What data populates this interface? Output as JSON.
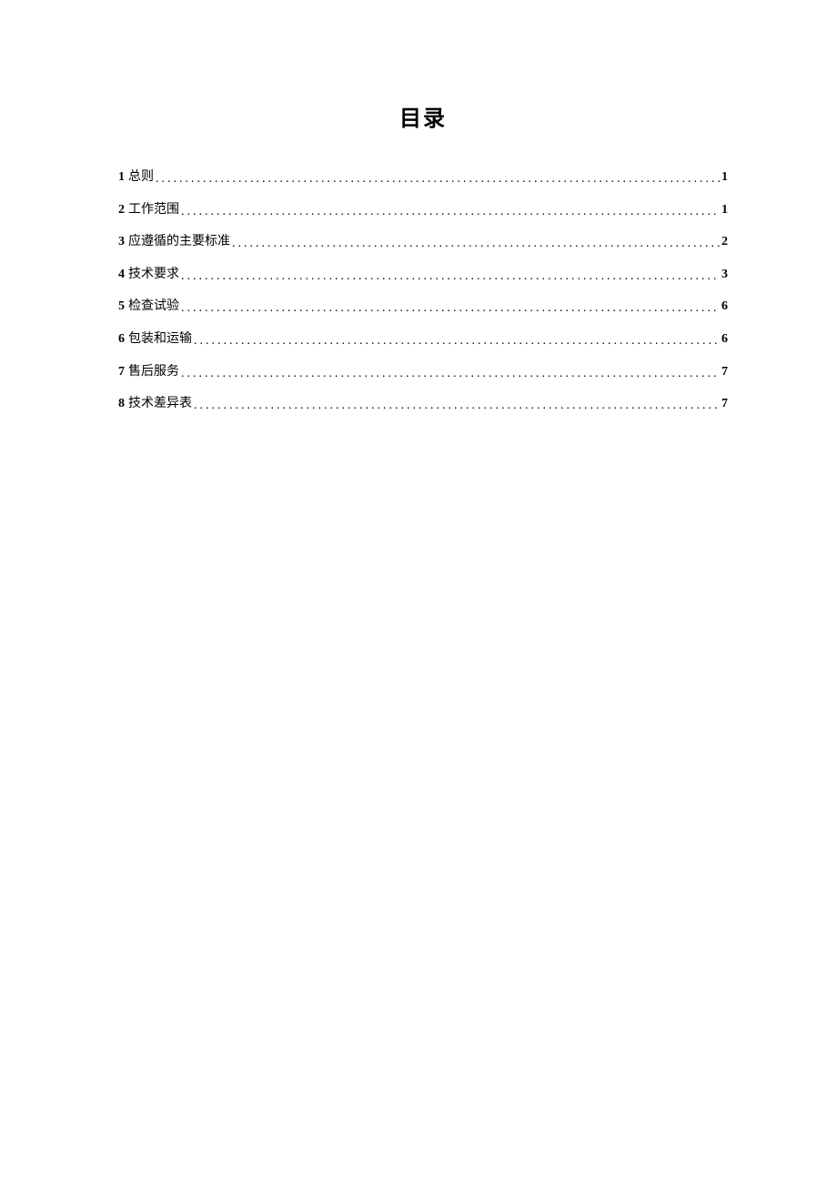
{
  "title": "目录",
  "toc": [
    {
      "num": "1",
      "label": "总则",
      "page": "1"
    },
    {
      "num": "2",
      "label": "工作范围",
      "page": "1"
    },
    {
      "num": "3",
      "label": "应遵循的主要标准",
      "page": "2"
    },
    {
      "num": "4",
      "label": "技术要求",
      "page": "3"
    },
    {
      "num": "5",
      "label": "检查试验",
      "page": "6"
    },
    {
      "num": "6",
      "label": "包装和运输",
      "page": "6"
    },
    {
      "num": "7",
      "label": "售后服务",
      "page": "7"
    },
    {
      "num": "8",
      "label": "技术差异表",
      "page": "7"
    }
  ]
}
